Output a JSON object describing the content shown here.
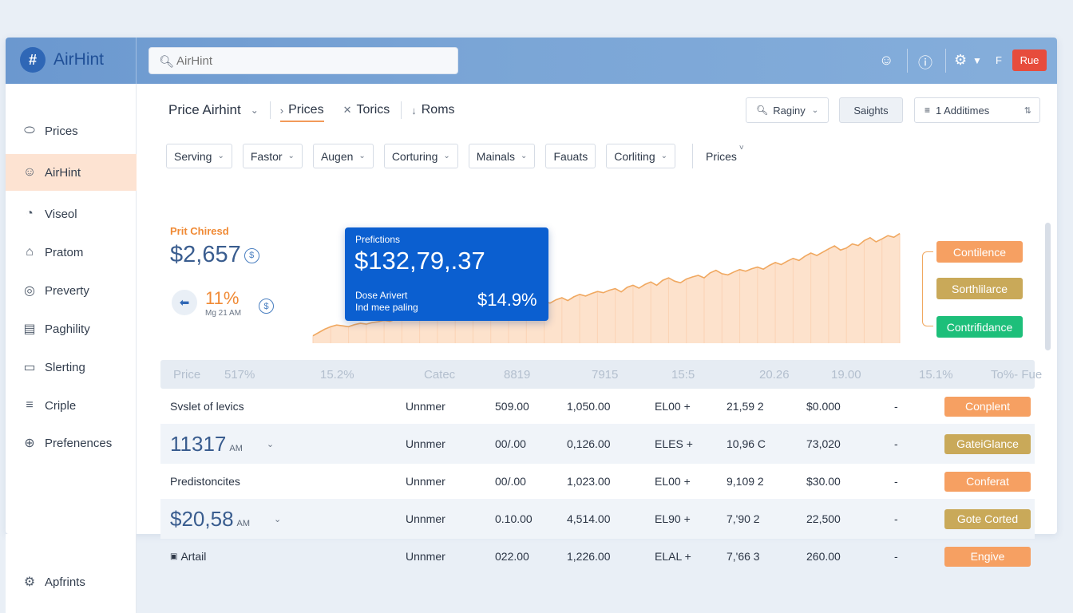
{
  "app": {
    "logo_text": "AirHint",
    "search_placeholder": "AirHint",
    "topbar_letter": "F",
    "topbar_button": "Rue"
  },
  "sidebar": {
    "items": [
      {
        "label": "Prices",
        "icon": "tag-icon"
      },
      {
        "label": "AirHint",
        "icon": "user-icon",
        "active": true
      },
      {
        "label": "Viseol",
        "icon": "chart-icon"
      },
      {
        "label": "Pratom",
        "icon": "home-icon"
      },
      {
        "label": "Preverty",
        "icon": "box-icon"
      },
      {
        "label": "Paghility",
        "icon": "calendar-icon"
      },
      {
        "label": "Slerting",
        "icon": "folder-icon"
      },
      {
        "label": "Criple",
        "icon": "list-icon"
      },
      {
        "label": "Preferences",
        "display": "Prefenences",
        "icon": "globe-icon"
      }
    ],
    "footer_item": {
      "label": "Apfrints",
      "icon": "settings-icon"
    }
  },
  "breadcrumb": {
    "title": "Price Airhint",
    "items": [
      {
        "label": "Prices",
        "active": true
      },
      {
        "label": "Torics"
      },
      {
        "label": "Roms"
      }
    ]
  },
  "controls": {
    "region": "Raginy",
    "insights": "Saights",
    "additions": "1 Additimes"
  },
  "filters": [
    {
      "label": "Serving"
    },
    {
      "label": "Fastor"
    },
    {
      "label": "Augen"
    },
    {
      "label": "Corturing"
    },
    {
      "label": "Mainals"
    },
    {
      "label": "Fauats",
      "plain_chevron": false
    },
    {
      "label": "Corliting"
    }
  ],
  "filter_extra": "Prices",
  "kpi": {
    "label": "Prit Chiresd",
    "value": "$2,657",
    "pct": "11%",
    "sub": "Mg 21 AM"
  },
  "tooltip": {
    "label": "Prefictions",
    "value": "$132,79,.37",
    "sub1": "Dose Arivert",
    "sub2": "Ind mee paling",
    "pct": "$14.9%"
  },
  "legend": [
    {
      "label": "Contilence",
      "color": "#f6a062"
    },
    {
      "label": "Sorthlilarce",
      "color": "#c9a959"
    },
    {
      "label": "Contrifidance",
      "color": "#1dbf7a"
    }
  ],
  "chart_data": {
    "type": "area",
    "series": [
      {
        "values": [
          18,
          26,
          34,
          40,
          44,
          42,
          40,
          45,
          48,
          46,
          50,
          52,
          55,
          53,
          58,
          60,
          57,
          62,
          64,
          66,
          63,
          68,
          70,
          72,
          69,
          75,
          73,
          76,
          74,
          78,
          80,
          77,
          82,
          85,
          84,
          88,
          92,
          90,
          96,
          100,
          97,
          105,
          110,
          103,
          112,
          118,
          114,
          120,
          125,
          122,
          128,
          132,
          124,
          135,
          140,
          133,
          142,
          148,
          140,
          152,
          158,
          150,
          146,
          155,
          160,
          164,
          158,
          170,
          176,
          168,
          165,
          172,
          178,
          174,
          180,
          184,
          179,
          188,
          195,
          190,
          198,
          205,
          200,
          210,
          218,
          212,
          220,
          228,
          235,
          225,
          230,
          240,
          236,
          248,
          255,
          245,
          252,
          260,
          256,
          265
        ]
      }
    ],
    "color": "#f0a860",
    "fill": "#fde2cc",
    "grid": false
  },
  "table": {
    "headers": [
      "Price",
      "517%",
      "15.2%",
      "Catec",
      "8819",
      "7915",
      "15:5",
      "20.26",
      "19.00",
      "15.1%",
      "To%- Fue"
    ],
    "rows": [
      {
        "name": "Svslet of levics",
        "type": "Unnmer",
        "c1": "509.00",
        "c2": "1,050.00",
        "c3": "EL00 +",
        "c4": "21,59 2",
        "c5": "$0.000",
        "c6": "-",
        "status": "Conplent",
        "status_color": "#f6a062"
      },
      {
        "name": "11317",
        "name_suffix": "AM",
        "big": true,
        "type": "Unnmer",
        "c1": "00/.00",
        "c2": "0,126.00",
        "c3": "ELES +",
        "c4": "10,96 C",
        "c5": "73,020",
        "c6": "-",
        "status": "GateiGlance",
        "status_color": "#c9a959"
      },
      {
        "name": "Predistoncites",
        "type": "Unnmer",
        "c1": "00/.00",
        "c2": "1,023.00",
        "c3": "EL00 +",
        "c4": "9,109 2",
        "c5": "$30.00",
        "c6": "-",
        "status": "Conferat",
        "status_color": "#f6a062"
      },
      {
        "name": "$20,58",
        "name_suffix": "AM",
        "big": true,
        "type": "Unnmer",
        "c1": "0.10.00",
        "c2": "4,514.00",
        "c3": "EL90 +",
        "c4": "7,'90 2",
        "c5": "22,500",
        "c6": "-",
        "status": "Gote Corted",
        "status_color": "#c9a959"
      },
      {
        "name": "Artail",
        "icon": true,
        "type": "Unnmer",
        "c1": "022.00",
        "c2": "1,226.00",
        "c3": "ELAL +",
        "c4": "7,'66 3",
        "c5": "260.00",
        "c6": "-",
        "status": "Engive",
        "status_color": "#f6a062"
      }
    ]
  }
}
